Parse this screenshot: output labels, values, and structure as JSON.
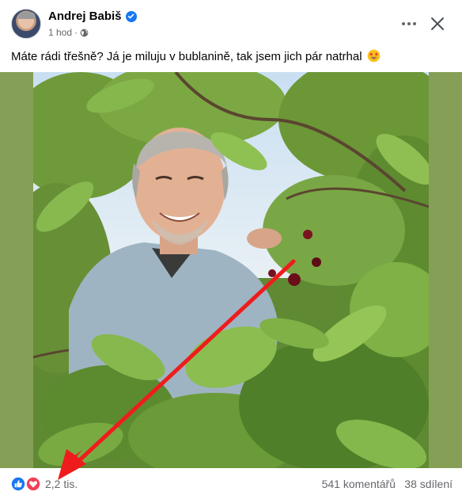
{
  "post": {
    "author": "Andrej Babiš",
    "time": "1 hod",
    "meta_separator": "·",
    "caption": "Máte rádi třešně? Já je miluju v bublanině, tak jsem jich pár natrhal"
  },
  "icons": {
    "verified": "verified-badge-icon",
    "privacy": "globe-icon",
    "more": "more-options-icon",
    "close": "close-icon",
    "emoji": "star-struck-emoji",
    "like": "like-reaction-icon",
    "love": "love-reaction-icon"
  },
  "stats": {
    "reactions": "2,2 tis.",
    "comments": "541 komentářů",
    "shares": "38 sdílení"
  },
  "colors": {
    "brand_blue": "#1877f2",
    "love_red": "#f33e58",
    "secondary_text": "#65676b",
    "photo_border_green": "#869f56",
    "annotation_arrow": "#ee1c1c"
  }
}
